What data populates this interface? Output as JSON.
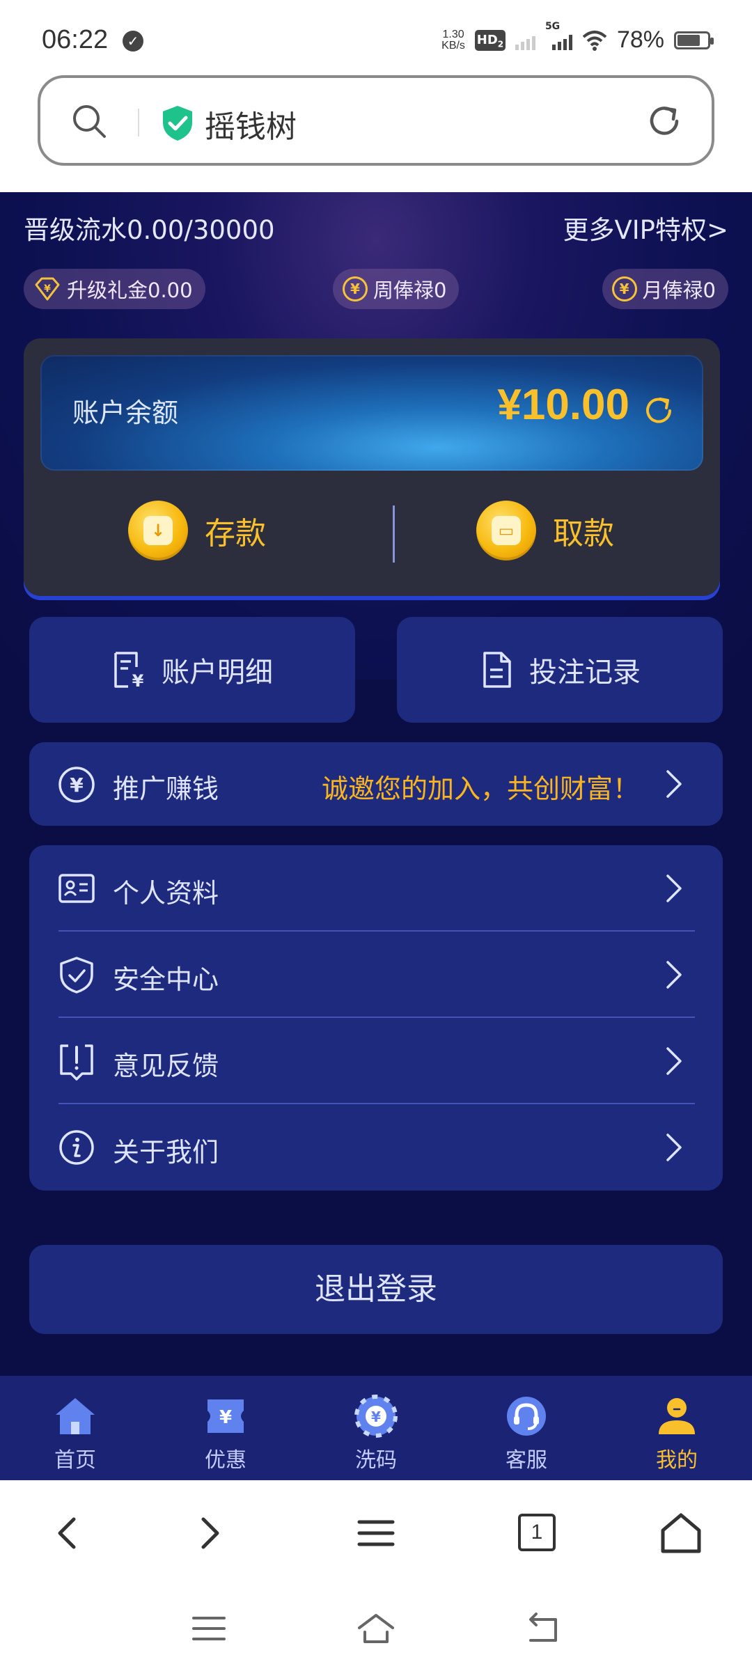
{
  "status_bar": {
    "time": "06:22",
    "net_speed_value": "1.30",
    "net_speed_unit": "KB/s",
    "hd": "HD",
    "hd_sub": "2",
    "network": "5G",
    "battery": "78%"
  },
  "browser": {
    "site_title": "摇钱树"
  },
  "vip": {
    "progress": "晋级流水0.00/30000",
    "more": "更多VIP特权>",
    "perks": [
      {
        "label": "升级礼金0.00",
        "icon": "diamond-yen-icon"
      },
      {
        "label": "周俸禄0",
        "icon": "yen-coin-icon"
      },
      {
        "label": "月俸禄0",
        "icon": "yen-coin-icon"
      }
    ]
  },
  "wallet": {
    "balance_label": "账户余额",
    "balance_amount": "¥10.00",
    "deposit": "存款",
    "withdraw": "取款"
  },
  "quick_actions": {
    "account_detail": "账户明细",
    "bet_records": "投注记录"
  },
  "promo": {
    "label": "推广赚钱",
    "slogan": "诚邀您的加入，共创财富！"
  },
  "menu": {
    "items": [
      {
        "label": "个人资料",
        "icon": "id-card-icon"
      },
      {
        "label": "安全中心",
        "icon": "shield-check-icon"
      },
      {
        "label": "意见反馈",
        "icon": "feedback-icon"
      },
      {
        "label": "关于我们",
        "icon": "info-icon"
      }
    ]
  },
  "logout": "退出登录",
  "tabbar": {
    "items": [
      {
        "label": "首页",
        "icon": "home-icon",
        "active": false
      },
      {
        "label": "优惠",
        "icon": "coupon-icon",
        "active": false
      },
      {
        "label": "洗码",
        "icon": "chip-icon",
        "active": false
      },
      {
        "label": "客服",
        "icon": "headset-icon",
        "active": false
      },
      {
        "label": "我的",
        "icon": "user-icon",
        "active": true
      }
    ]
  },
  "browser_nav": {
    "tab_count": "1"
  },
  "colors": {
    "app_background": "#0b0d45",
    "card": "#1e2a7e",
    "accent_gold": "#f9c02b",
    "promo_text": "#f9b51f",
    "text_light": "#dfe4ff"
  }
}
